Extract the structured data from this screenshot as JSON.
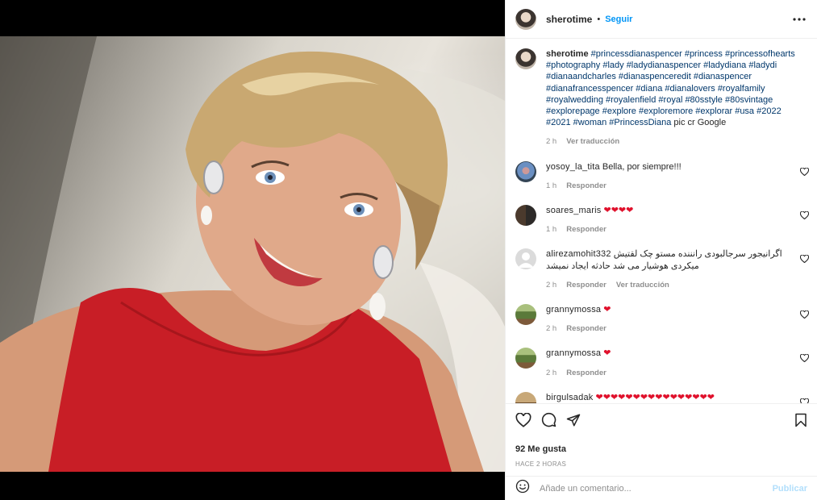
{
  "post": {
    "owner": "sherotime",
    "separator": "•",
    "follow_label": "Seguir",
    "caption": {
      "user": "sherotime",
      "tags": "#princessdianaspencer #princess #princessofhearts #photography #lady #ladydianaspencer #ladydiana #ladydi #dianaandcharles #dianaspenceredit #dianaspencer #dianafrancesspencer #diana #dianalovers #royalfamily #royalwedding #royalenfield #royal #80sstyle #80svintage #explorepage #explore #exploremore #explorar #usa #2022 #2021 #woman #PrincessDiana",
      "trailing": " pic cr Google",
      "time": "2 h",
      "translate": "Ver traducción"
    },
    "comments": [
      {
        "user": "yosoy_la_tita",
        "text": "Bella, por siempre!!!",
        "time": "1 h",
        "reply": "Responder",
        "translate": ""
      },
      {
        "user": "soares_maris",
        "text": "❤❤❤❤",
        "time": "1 h",
        "reply": "Responder",
        "translate": ""
      },
      {
        "user": "alirezamohit332",
        "text": "اگرانیجور سرجالبودی رانننده مستو چک لقتیش میکردی هوشیار می شد حادثه ایجاد نمیشد",
        "time": "2 h",
        "reply": "Responder",
        "translate": "Ver traducción"
      },
      {
        "user": "grannymossa",
        "text": "❤",
        "time": "2 h",
        "reply": "Responder",
        "translate": ""
      },
      {
        "user": "grannymossa",
        "text": "❤",
        "time": "2 h",
        "reply": "Responder",
        "translate": ""
      },
      {
        "user": "birgulsadak",
        "text": "❤❤❤❤❤❤❤❤❤❤❤❤❤❤❤❤",
        "time": "",
        "reply": "",
        "translate": ""
      }
    ],
    "likes": "92 Me gusta",
    "posted": "HACE 2 HORAS",
    "comment_placeholder": "Añade un comentario...",
    "publish_label": "Publicar"
  },
  "icons": {
    "more": "more-horizontal-icon",
    "like": "heart-outline-icon",
    "comment": "speech-bubble-icon",
    "share": "paper-plane-icon",
    "save": "bookmark-icon",
    "emoji": "smiley-icon"
  },
  "colors": {
    "link": "#0095f6",
    "hashtag": "#00376b",
    "heart": "#e0112c",
    "muted": "#8e8e8e",
    "publish_disabled": "#b2dffc"
  }
}
